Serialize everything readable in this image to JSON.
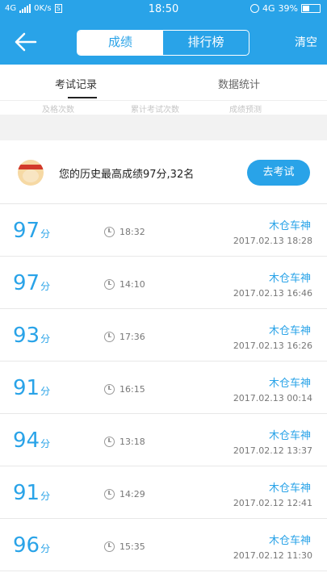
{
  "status_bar": {
    "network": "4G",
    "speed": "0K/s",
    "time": "18:50",
    "network_right": "4G",
    "battery": "39%"
  },
  "header": {
    "tab_active": "成绩",
    "tab_inactive": "排行榜",
    "clear_label": "清空"
  },
  "tabs": {
    "tab1": "考试记录",
    "tab2": "数据统计"
  },
  "stats_row": [
    "及格次数",
    "累计考试次数",
    "成绩预测"
  ],
  "best": {
    "text": "您的历史最高成绩97分,32名",
    "button": "去考试"
  },
  "records": [
    {
      "score": "97",
      "unit": "分",
      "duration": "18:32",
      "user": "木仓车神",
      "date": "2017.02.13 18:28"
    },
    {
      "score": "97",
      "unit": "分",
      "duration": "14:10",
      "user": "木仓车神",
      "date": "2017.02.13 16:46"
    },
    {
      "score": "93",
      "unit": "分",
      "duration": "17:36",
      "user": "木仓车神",
      "date": "2017.02.13 16:26"
    },
    {
      "score": "91",
      "unit": "分",
      "duration": "16:15",
      "user": "木仓车神",
      "date": "2017.02.13 00:14"
    },
    {
      "score": "94",
      "unit": "分",
      "duration": "13:18",
      "user": "木仓车神",
      "date": "2017.02.12 13:37"
    },
    {
      "score": "91",
      "unit": "分",
      "duration": "14:29",
      "user": "木仓车神",
      "date": "2017.02.12 12:41"
    },
    {
      "score": "96",
      "unit": "分",
      "duration": "15:35",
      "user": "木仓车神",
      "date": "2017.02.12 11:30"
    }
  ],
  "colors": {
    "accent": "#29a3e8"
  }
}
